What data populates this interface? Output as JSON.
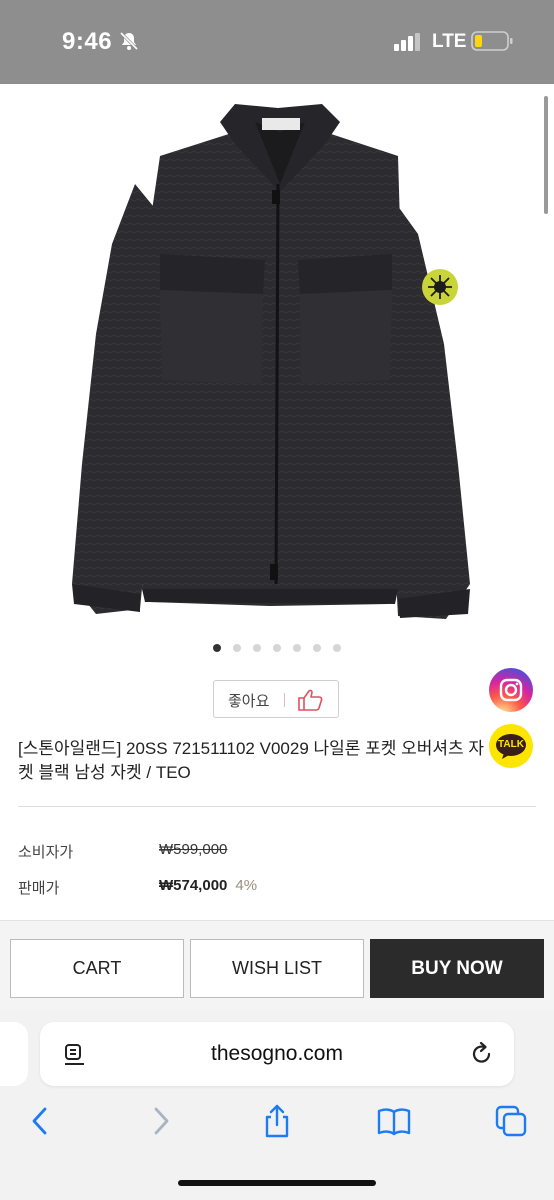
{
  "status_bar": {
    "time": "9:46",
    "network": "LTE",
    "icons": [
      "bell-slash-icon",
      "signal-icon",
      "battery-icon"
    ]
  },
  "product": {
    "image": {
      "description_icon": "jacket-image",
      "patch_color": "#c9d33a",
      "garment_color": "#2c2c30"
    },
    "carousel": {
      "count": 7,
      "active": 1
    },
    "like_label": "좋아요",
    "title": "[스톤아일랜드] 20SS 721511102 V0029 나일론 포켓 오버셔츠 자켓 블랙 남성 자켓 / TEO",
    "consumer_price_label": "소비자가",
    "consumer_price": "₩599,000",
    "sale_price_label": "판매가",
    "sale_price": "₩574,000",
    "discount": "4%"
  },
  "floating": {
    "instagram_icon": "instagram-icon",
    "talk_label": "TALK"
  },
  "actions": {
    "cart_label": "CART",
    "wish_label": "WISH LIST",
    "buy_label": "BUY NOW"
  },
  "browser": {
    "url": "thesogno.com",
    "toolbar": [
      "back-icon",
      "forward-icon",
      "share-icon",
      "bookmarks-icon",
      "tabs-icon"
    ]
  },
  "colors": {
    "status_bar": "#8e8e8e",
    "buy_now": "#2b2b2b",
    "safari_blue": "#1e7cf2",
    "kakao": "#fee500"
  }
}
